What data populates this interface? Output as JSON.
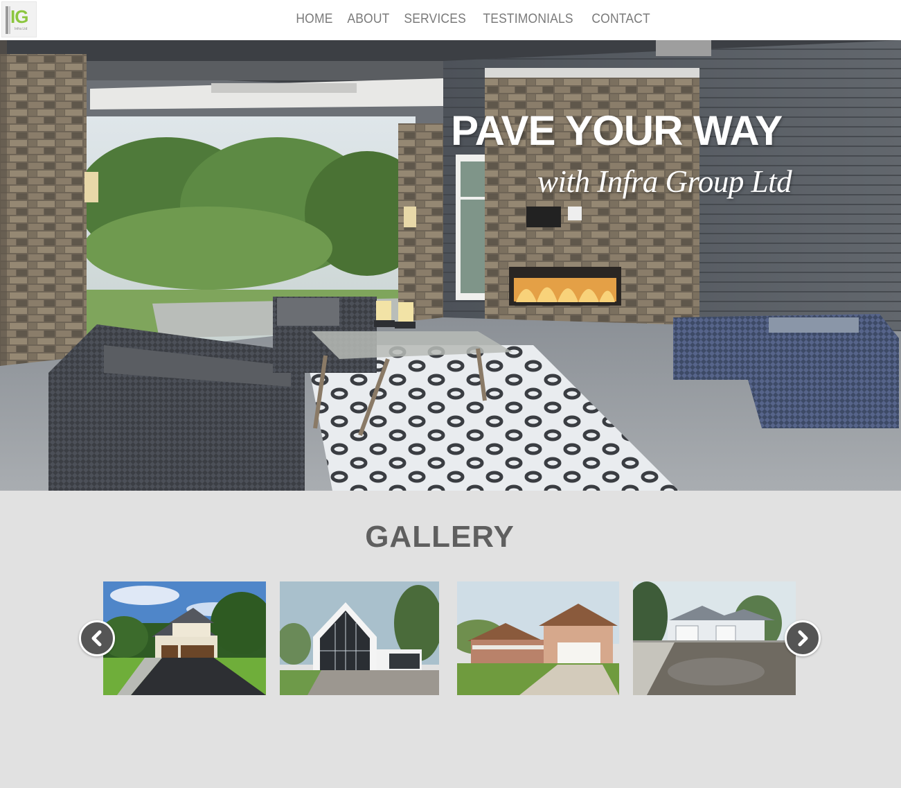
{
  "logo": {
    "letters": "IG",
    "sub": "Infra Ltd"
  },
  "nav": {
    "items": [
      {
        "label": "HOME"
      },
      {
        "label": "ABOUT"
      },
      {
        "label": "SERVICES"
      },
      {
        "label": "TESTIMONIALS"
      },
      {
        "label": "CONTACT"
      }
    ]
  },
  "hero": {
    "title": "PAVE YOUR WAY",
    "subtitle": "with Infra Group Ltd"
  },
  "gallery": {
    "title": "GALLERY",
    "prev_icon": "chevron-left-icon",
    "next_icon": "chevron-right-icon"
  },
  "colors": {
    "logo_green": "#8cc63f",
    "nav_text": "#7a7a7a",
    "page_bg": "#e1e1e1",
    "arrow_bg": "#555555"
  }
}
